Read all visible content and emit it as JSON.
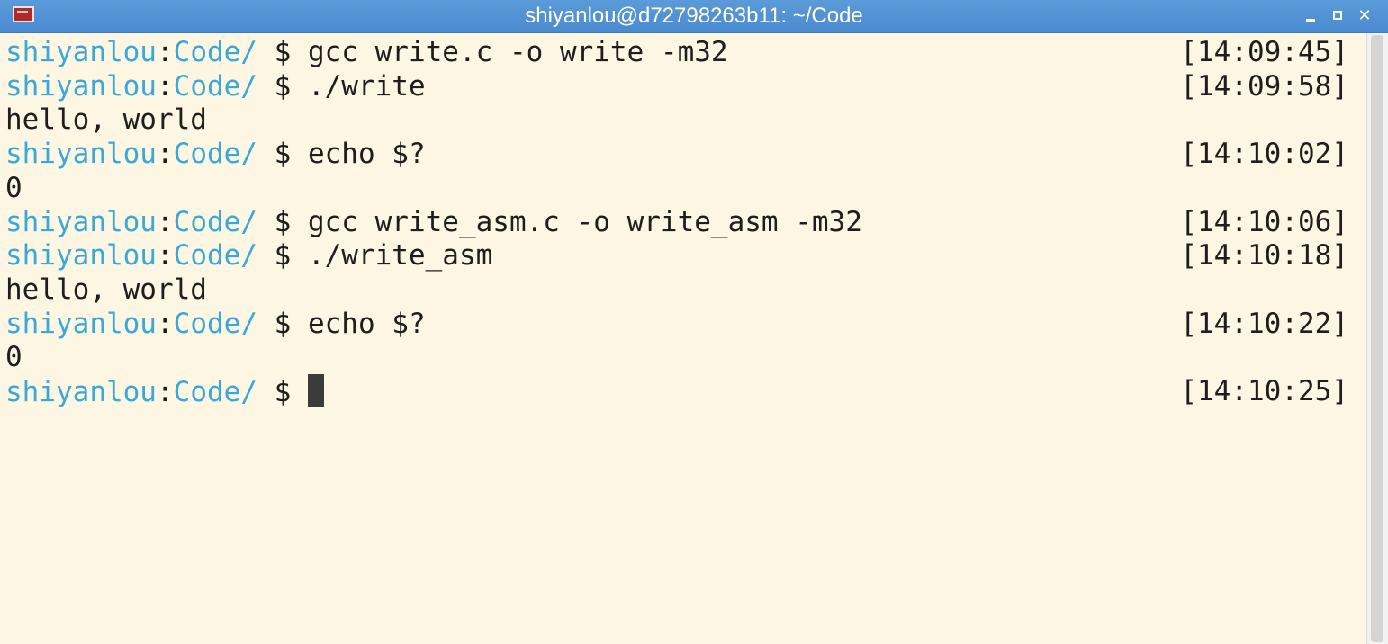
{
  "window": {
    "title": "shiyanlou@d72798263b11: ~/Code",
    "icon": "terminal-app-icon",
    "controls": [
      "minimize-icon",
      "maximize-icon",
      "close-icon"
    ],
    "close_glyph": "✕"
  },
  "prompt": {
    "user": "shiyanlou",
    "colon": ":",
    "dir": "Code/",
    "symbol": " $ "
  },
  "lines": [
    {
      "type": "prompt",
      "cmd": "gcc write.c -o write -m32",
      "time": "[14:09:45]"
    },
    {
      "type": "prompt",
      "cmd": "./write",
      "time": "[14:09:58]"
    },
    {
      "type": "output",
      "text": "hello, world"
    },
    {
      "type": "prompt",
      "cmd": "echo $?",
      "time": "[14:10:02]"
    },
    {
      "type": "output",
      "text": "0"
    },
    {
      "type": "prompt",
      "cmd": "gcc write_asm.c -o write_asm -m32",
      "time": "[14:10:06]"
    },
    {
      "type": "prompt",
      "cmd": "./write_asm",
      "time": "[14:10:18]"
    },
    {
      "type": "output",
      "text": "hello, world"
    },
    {
      "type": "prompt",
      "cmd": "echo $?",
      "time": "[14:10:22]"
    },
    {
      "type": "output",
      "text": "0"
    },
    {
      "type": "prompt",
      "cmd": "",
      "time": "[14:10:25]",
      "cursor": true
    }
  ],
  "colors": {
    "background": "#fdf6e3",
    "prompt_user": "#3aa8d8",
    "text": "#1e1e1e",
    "titlebar": "#4a8ad0"
  }
}
